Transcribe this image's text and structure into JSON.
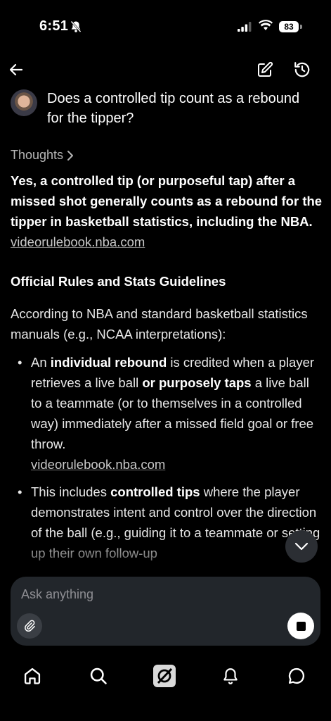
{
  "status_bar": {
    "time": "6:51",
    "battery": "83"
  },
  "header": {
    "back_icon": "arrow-left-icon",
    "edit_icon": "edit-icon",
    "history_icon": "history-icon"
  },
  "question": "Does a controlled tip count as a rebound for the tipper?",
  "thoughts_label": "Thoughts",
  "answer": {
    "text": "Yes, a controlled tip (or purposeful tap) after a missed shot generally counts as a rebound for the tipper in basketball statistics, including the NBA.",
    "source": "videorulebook.nba.com"
  },
  "section_title": "Official Rules and Stats Guidelines",
  "intro": "According to NBA and standard basketball statistics manuals (e.g., NCAA interpretations):",
  "bullets": {
    "b1": {
      "pre": "An ",
      "bold1": "individual rebound",
      "mid": " is credited when a player retrieves a live ball ",
      "bold2": "or purposely taps",
      "post": " a live ball to a teammate (or to themselves in a controlled way) immediately after a missed field goal or free throw.",
      "source": "videorulebook.nba.com"
    },
    "b2": {
      "pre": "This includes ",
      "bold1": "controlled tips",
      "post": " where the player demonstrates intent and control over the direction of the ball (e.g., guiding it to a teammate or setting up their own follow-up"
    }
  },
  "composer": {
    "placeholder": "Ask anything"
  },
  "tabs": [
    "home-icon",
    "search-icon",
    "grok-icon",
    "notifications-icon",
    "messages-icon"
  ]
}
